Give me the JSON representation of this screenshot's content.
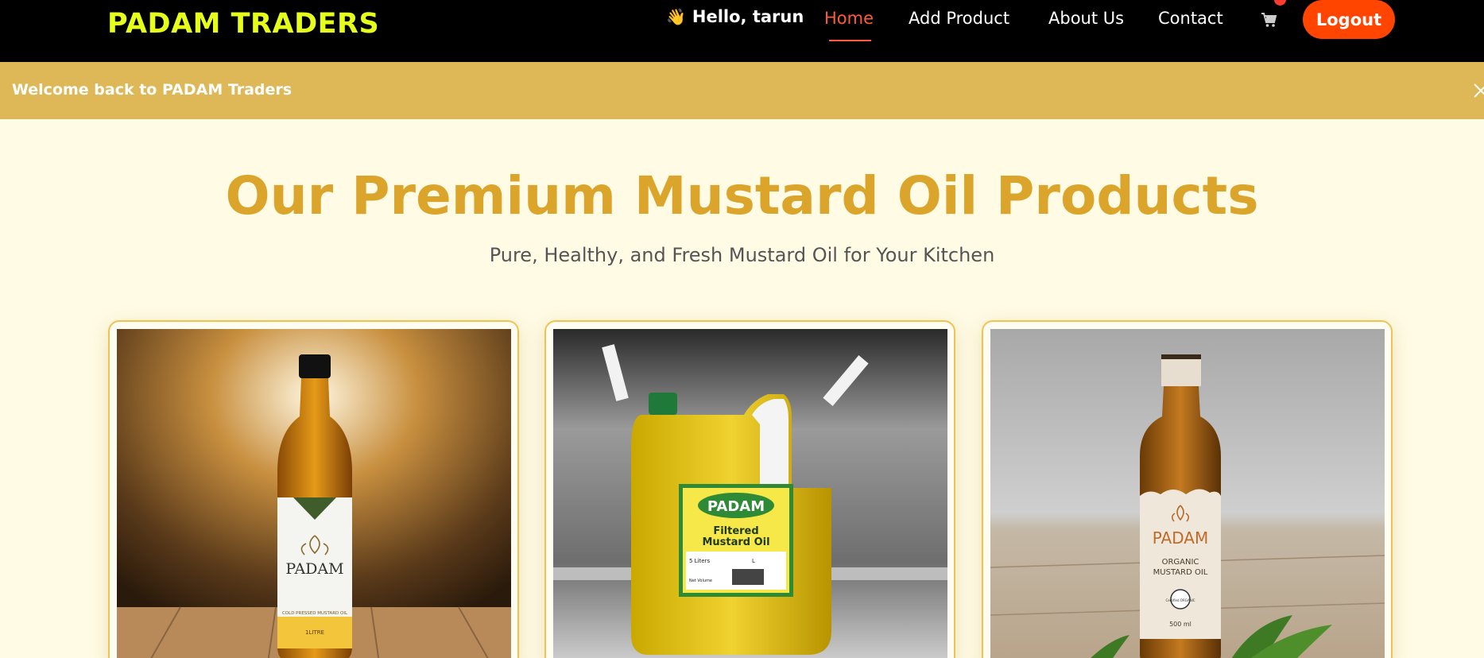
{
  "nav": {
    "brand": "PADAM TRADERS",
    "wave": "👋",
    "greeting": "Hello, tarun",
    "links": [
      {
        "label": "Home",
        "active": true
      },
      {
        "label": "Add Product",
        "active": false
      },
      {
        "label": "About Us",
        "active": false
      },
      {
        "label": "Contact",
        "active": false
      }
    ],
    "cart_icon": "cart-icon",
    "logout": "Logout"
  },
  "banner": {
    "message": "Welcome back to PADAM Traders",
    "close_icon": "close-icon"
  },
  "hero": {
    "title": "Our Premium Mustard Oil Products",
    "subtitle": "Pure, Healthy, and Fresh Mustard Oil for Your Kitchen"
  },
  "products": [
    {
      "brand": "PADAM",
      "label_line": "COLD PRESSED MUSTARD OIL",
      "volume": "1LITRE"
    },
    {
      "brand": "PADAM",
      "label_line1": "Filtered",
      "label_line2": "Mustard Oil",
      "volume": "5 Liters",
      "volume_mark": "L",
      "net": "Net Volume"
    },
    {
      "brand": "PADAM",
      "label_line1": "ORGANIC",
      "label_line2": "MUSTARD OIL",
      "seal": "Certified ORGANIC",
      "volume": "500 ml"
    }
  ],
  "colors": {
    "navbar": "#000000",
    "brand": "#e5ff1a",
    "accent": "#ff5a3c",
    "logout": "#ff4500",
    "banner": "#deb857",
    "title": "#dba42a",
    "page_bg": "#fffbe5",
    "card_border": "#f2c24f"
  }
}
